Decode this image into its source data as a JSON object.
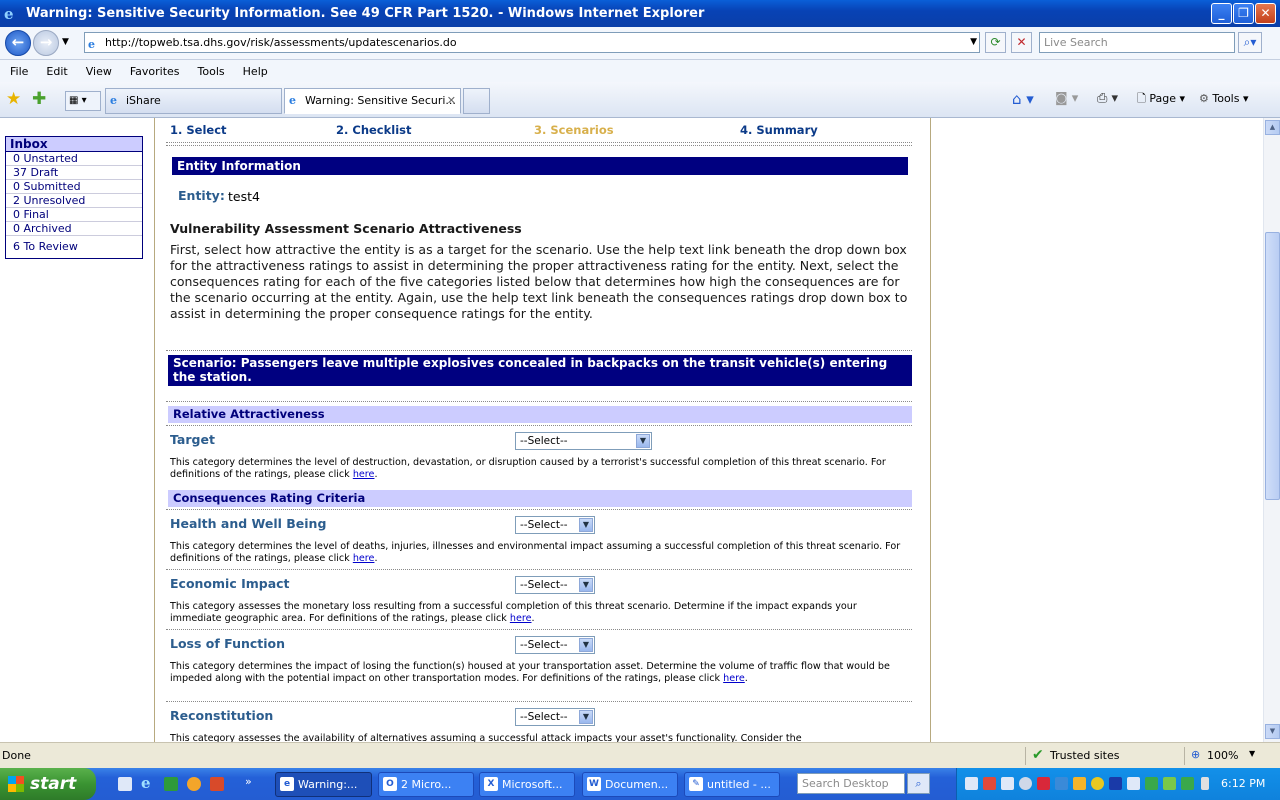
{
  "window": {
    "title": "Warning: Sensitive Security Information. See 49 CFR Part 1520. - Windows Internet Explorer"
  },
  "address": {
    "url": "http://topweb.tsa.dhs.gov/risk/assessments/updatescenarios.do",
    "search_placeholder": "Live Search"
  },
  "menu": [
    "File",
    "Edit",
    "View",
    "Favorites",
    "Tools",
    "Help"
  ],
  "tabs": [
    {
      "label": "iShare"
    },
    {
      "label": "Warning: Sensitive Securi..."
    }
  ],
  "commandbar": {
    "page": "Page",
    "tools": "Tools"
  },
  "inbox": {
    "title": "Inbox",
    "items": [
      "0 Unstarted",
      "37 Draft",
      "0 Submitted",
      "2 Unresolved",
      "0 Final",
      "0 Archived"
    ],
    "review": "6 To Review"
  },
  "steps": [
    "1. Select",
    "2. Checklist",
    "3. Scenarios",
    "4. Summary"
  ],
  "entity": {
    "section_title": "Entity Information",
    "label": "Entity:",
    "value": "test4"
  },
  "intro": {
    "heading": "Vulnerability Assessment Scenario Attractiveness",
    "text": "First, select how attractive the entity is as a target for the scenario. Use the help text link beneath the drop down box for the attractiveness ratings to assist in determining the proper attractiveness rating for the entity. Next, select the consequences rating for each of the five categories listed below that determines how high the consequences are for the scenario occurring at the entity. Again, use the help text link beneath the consequences ratings drop down box to assist in determining the proper consequence ratings for the entity."
  },
  "scenario": {
    "title": "Scenario: Passengers leave multiple explosives concealed in backpacks on the transit vehicle(s) entering the station."
  },
  "attractiveness": {
    "section": "Relative Attractiveness",
    "label": "Target",
    "select": "--Select--",
    "desc": "This category determines the level of destruction, devastation, or disruption caused by a terrorist's successful completion of this threat scenario. For definitions of the ratings, please click",
    "link": "here",
    "tail": "."
  },
  "consequences": {
    "section": "Consequences Rating Criteria",
    "items": [
      {
        "label": "Health and Well Being",
        "select": "--Select--",
        "desc": "This category determines the level of deaths, injuries, illnesses and environmental impact assuming a successful completion of this threat scenario. For definitions of the ratings, please click",
        "link": "here",
        "tail": "."
      },
      {
        "label": "Economic Impact",
        "select": "--Select--",
        "desc": "This category assesses the monetary loss resulting from a successful completion of this threat scenario. Determine if the impact expands your immediate geographic area. For definitions of the ratings, please click",
        "link": "here",
        "tail": "."
      },
      {
        "label": "Loss of Function",
        "select": "--Select--",
        "desc": "This category determines the impact of losing the function(s) housed at your transportation asset. Determine the volume of traffic flow that would be impeded along with the potential impact on other transportation modes. For definitions of the ratings, please click",
        "link": "here",
        "tail": "."
      },
      {
        "label": "Reconstitution",
        "select": "--Select--",
        "desc": "This category assesses the availability of alternatives assuming a successful attack impacts your asset's functionality. Consider the"
      }
    ]
  },
  "status": {
    "left": "Done",
    "zone": "Trusted sites",
    "zoom": "100%"
  },
  "taskbar": {
    "start": "start",
    "buttons": [
      "Warning:...",
      "2 Micro...",
      "Microsoft...",
      "Documen...",
      "untitled - ..."
    ],
    "desktop_search": "Search Desktop",
    "clock": "6:12 PM"
  }
}
